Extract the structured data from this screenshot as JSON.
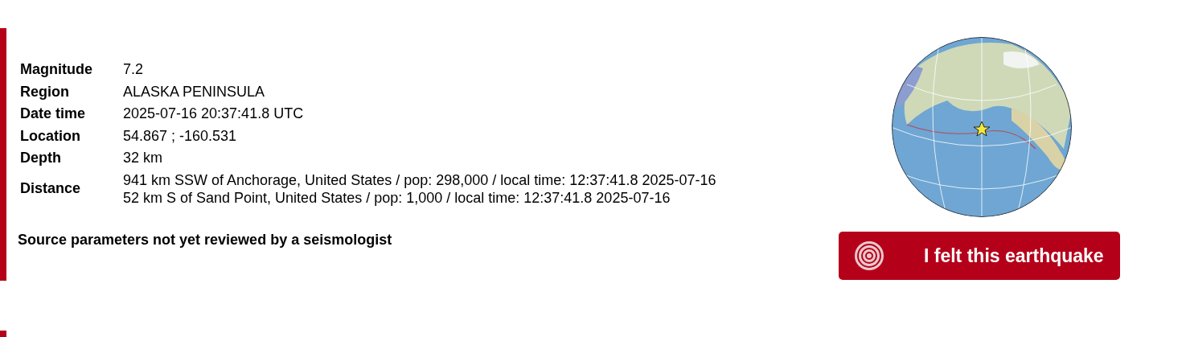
{
  "details": [
    {
      "label": "Magnitude",
      "values": [
        "7.2"
      ]
    },
    {
      "label": "Region",
      "values": [
        "ALASKA PENINSULA"
      ]
    },
    {
      "label": "Date time",
      "values": [
        "2025-07-16 20:37:41.8 UTC"
      ]
    },
    {
      "label": "Location",
      "values": [
        "54.867 ; -160.531"
      ]
    },
    {
      "label": "Depth",
      "values": [
        "32 km"
      ]
    },
    {
      "label": "Distance",
      "values": [
        "941 km SSW of Anchorage, United States / pop: 298,000 / local time: 12:37:41.8 2025-07-16",
        "52 km S of Sand Point, United States / pop: 1,000 / local time: 12:37:41.8 2025-07-16"
      ]
    }
  ],
  "review_note": "Source parameters not yet reviewed by a seismologist",
  "felt_button": {
    "label": "I felt this earthquake"
  }
}
